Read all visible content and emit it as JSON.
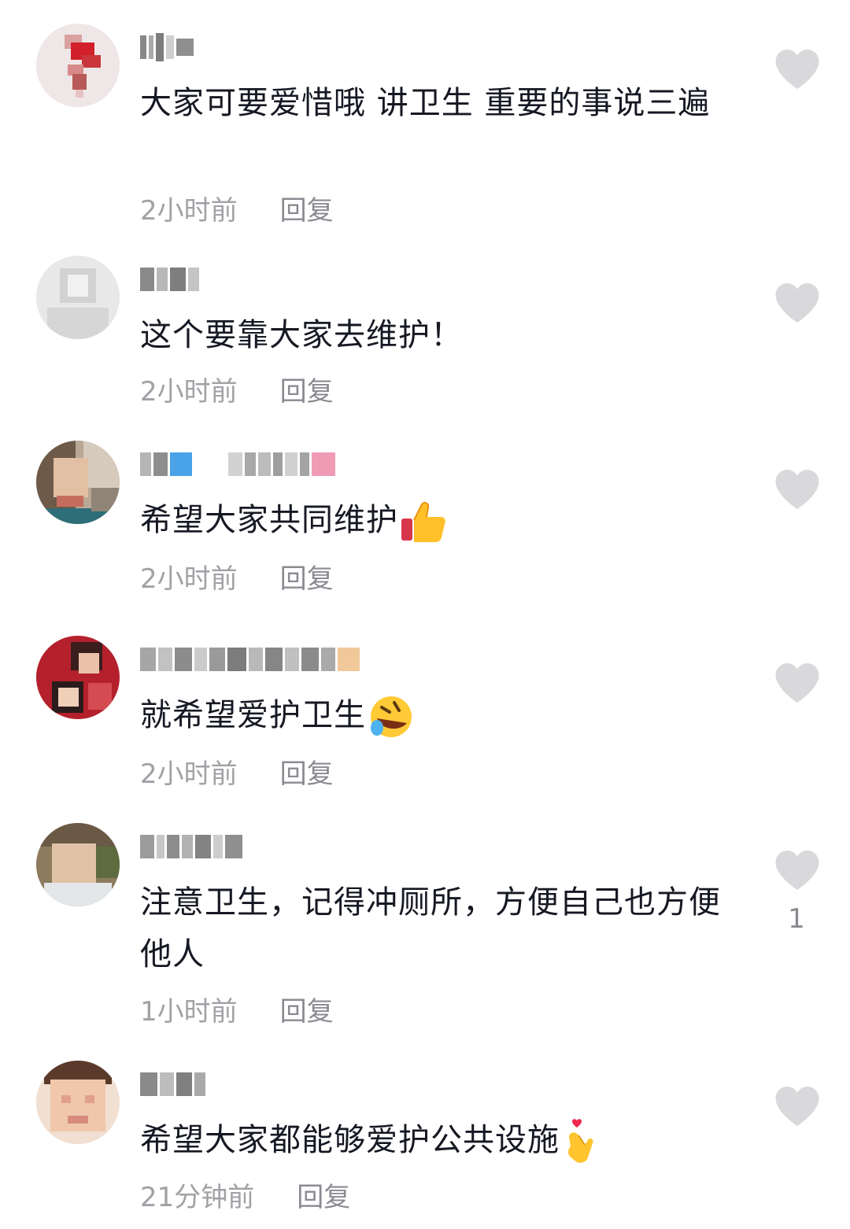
{
  "comments": [
    {
      "text": "大家可要爱惜哦 讲卫生 重要的事说三遍",
      "time": "2小时前",
      "reply": "回复",
      "like_count": ""
    },
    {
      "text": "这个要靠大家去维护！",
      "time": "2小时前",
      "reply": "回复",
      "like_count": ""
    },
    {
      "text": "希望大家共同维护",
      "time": "2小时前",
      "reply": "回复",
      "like_count": "",
      "emoji": "thumbs-up-icon"
    },
    {
      "text": "就希望爱护卫生",
      "time": "2小时前",
      "reply": "回复",
      "like_count": "",
      "emoji": "rolling-laughing-icon"
    },
    {
      "text": "注意卫生，记得冲厕所，方便自己也方便他人",
      "time": "1小时前",
      "reply": "回复",
      "like_count": "1"
    },
    {
      "text": "希望大家都能够爱护公共设施",
      "time": "21分钟前",
      "reply": "回复",
      "like_count": "",
      "emoji": "finger-heart-icon"
    }
  ],
  "colors": {
    "text": "#161823",
    "meta": "#a1a1a6",
    "heart": "#d9d9dc"
  }
}
